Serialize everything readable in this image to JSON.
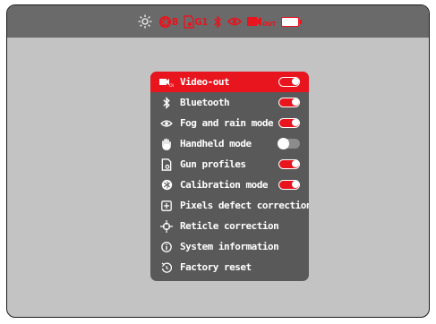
{
  "statusbar": {
    "icons": [
      "brightness-icon",
      "calibration-icon",
      "gun-profile-icon",
      "bluetooth-icon",
      "fog-rain-icon",
      "video-out-icon",
      "battery-icon"
    ],
    "calibration_letter": "B",
    "gun_profile_text": "G1",
    "video_out_sub": "OUT"
  },
  "menu": {
    "items": [
      {
        "label": "Video-out",
        "icon": "video-out-icon",
        "icon_sub": "OUT",
        "toggle": "on",
        "selected": true
      },
      {
        "label": "Bluetooth",
        "icon": "bluetooth-icon",
        "toggle": "on"
      },
      {
        "label": "Fog and rain mode",
        "icon": "fog-rain-icon",
        "toggle": "on"
      },
      {
        "label": "Handheld mode",
        "icon": "hand-icon",
        "toggle": "off"
      },
      {
        "label": "Gun profiles",
        "icon": "gun-profile-icon",
        "toggle": "on"
      },
      {
        "label": "Calibration mode",
        "icon": "calibration-icon",
        "toggle": "on"
      },
      {
        "label": "Pixels defect correction",
        "icon": "pixel-defect-icon"
      },
      {
        "label": "Reticle correction",
        "icon": "reticle-icon"
      },
      {
        "label": "System information",
        "icon": "info-icon"
      },
      {
        "label": "Factory reset",
        "icon": "reset-icon"
      }
    ]
  },
  "colors": {
    "accent": "#e8141e",
    "panel": "#595959",
    "screen_bg": "#c3c3c3",
    "statusbar": "#6a6a6a"
  }
}
